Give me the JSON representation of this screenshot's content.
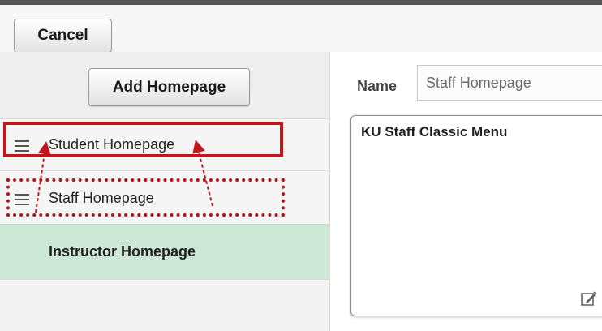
{
  "toolbar": {
    "cancel_label": "Cancel"
  },
  "sidebar": {
    "add_label": "Add Homepage",
    "items": [
      {
        "label": "Student Homepage",
        "icon": "drag-handle-icon"
      },
      {
        "label": "Staff Homepage",
        "icon": "drag-handle-icon"
      },
      {
        "label": "Instructor Homepage",
        "selected": true
      }
    ]
  },
  "detail": {
    "name_label": "Name",
    "name_value": "Staff Homepage",
    "tile_title": "KU Staff Classic Menu",
    "edit_icon": "edit-icon"
  },
  "colors": {
    "annotation_red": "#c0171c",
    "selected_row": "#cde8d6"
  }
}
